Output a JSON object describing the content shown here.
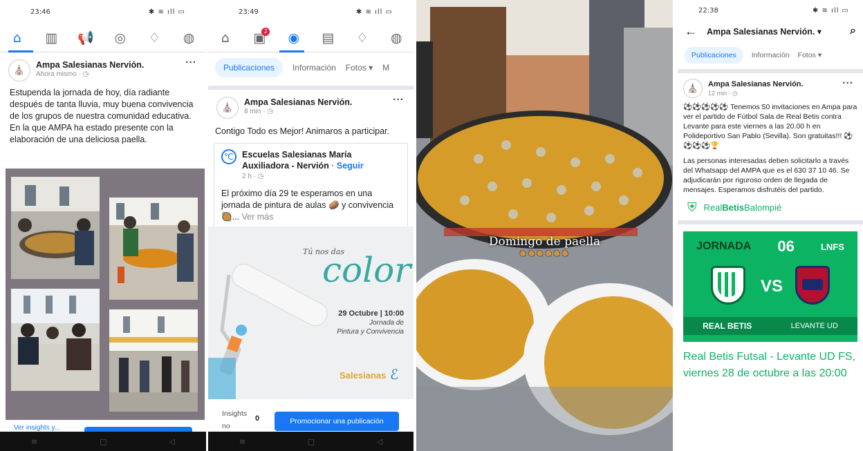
{
  "panel1": {
    "status_time": "23:46",
    "status_right": "✱ ≋ ıll ▭",
    "post": {
      "author": "Ampa Salesianas Nervión.",
      "time": "Ahora mismo · ◷",
      "text": "Estupenda la jornada de hoy, día radiante después de tanta lluvia, muy buena convivencia de los grupos de nuestra comunidad educativa. En la que AMPA ha estado presente con la elaboración de una deliciosa paella."
    },
    "insights_label": "Ver insights y..."
  },
  "panel2": {
    "status_time": "23:49",
    "status_right": "✱ ≋ ıll ▭",
    "notification_count": "2",
    "tabs": [
      "Publicaciones",
      "Información",
      "Fotos ▾",
      "M"
    ],
    "post": {
      "author": "Ampa Salesianas Nervión.",
      "time": "8 min · ◷",
      "text": "Contigo Todo es Mejor! Animaros a participar."
    },
    "shared": {
      "author": "Escuelas Salesianas María Auxiliadora - Nervión",
      "follow": "Seguir",
      "time": "2 h · ◷",
      "text": "El próximo día 29 te esperamos en una jornada de pintura de aulas 🥔 y convivencia 🥘...",
      "more": "Ver más"
    },
    "banner": {
      "tagline": "Tú nos das",
      "big": "color",
      "date": "29 Octubre | 10:00",
      "sub1": "Jornada de",
      "sub2": "Pintura y Convivencia",
      "brand": "Salesianas"
    },
    "insights_label": "Insights no",
    "insights_value": "0",
    "promote_button": "Promocionar una publicación"
  },
  "panel3": {
    "caption": "Domingo de paella",
    "emoji_row": "🥘🥘🥘🥘🥘🥘"
  },
  "panel4": {
    "status_time": "22:38",
    "status_right": "✱ ≋ ıll ▭",
    "header_title": "Ampa Salesianas Nervión. ▾",
    "tabs": [
      "Publicaciones",
      "Información",
      "Fotos ▾"
    ],
    "post": {
      "author": "Ampa Salesianas Nervión.",
      "time": "12 min · ◷",
      "text1": "Tenemos 50 invitaciones en Ampa para ver el partido de Fútbol Sala de Real Betis contra Levante para este viernes a las 20.00 h en Polideportivo San Pablo (Sevilla). Son gratuitas!!!",
      "text2": "Las personas interesadas deben solicitarlo a través del Whatsapp del AMPA que es el 630 37 10 46. Se adjudicarán por riguroso orden de llegada de mensajes. Esperamos disfrutéis del partido."
    },
    "club_name_a": "Real",
    "club_name_b": "Betis",
    "club_name_c": "Balompié",
    "match": {
      "jornada": "JORNADA",
      "num": "06",
      "league": "LNFS",
      "vs": "VS",
      "home": "REAL BETIS",
      "away": "LEVANTE UD"
    },
    "link_title": "Real Betis Futsal - Levante UD FS, viernes 28 de octubre a las 20:00"
  },
  "colors": {
    "fb_blue": "#1877f2",
    "betis_green": "#0bb363",
    "banner_teal": "#3aa8a0"
  }
}
